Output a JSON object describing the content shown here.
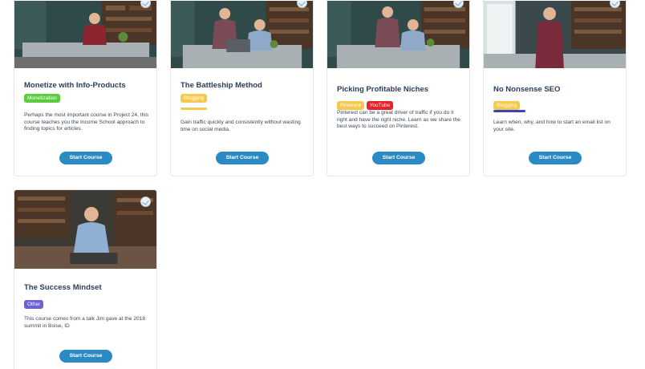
{
  "cards": [
    {
      "title": "Monetize with Info-Products",
      "tags": [
        {
          "label": "Monetization",
          "color": "#5ccc3f"
        }
      ],
      "description": "Perhaps the most important course in Project 24, this course teaches you the Income School approach to finding topics for articles.",
      "button": "Start Course"
    },
    {
      "title": "The Battleship Method",
      "tags": [
        {
          "label": "Blogging",
          "color": "#f6c84c"
        }
      ],
      "description": "Gain traffic quickly and consistently without wasting time on social media.",
      "button": "Start Course"
    },
    {
      "title": "Picking Profitable Niches",
      "tags": [
        {
          "label": "Pinterest",
          "color": "#f6c84c"
        },
        {
          "label": "YouTube",
          "color": "#e8222a"
        }
      ],
      "description": "Pinterest can be a great driver of traffic if you do it right and have the right niche. Learn as we share the best ways to succeed on Pinterest.",
      "button": "Start Course"
    },
    {
      "title": "No Nonsense SEO",
      "tags": [
        {
          "label": "Blogging",
          "color": "#f6c84c"
        }
      ],
      "description": "Learn when, why, and how to start an email list on your site.",
      "button": "Start Course"
    },
    {
      "title": "The Success Mindset",
      "tags": [
        {
          "label": "Other",
          "color": "#6b63cf"
        }
      ],
      "description": "This course comes from a talk Jim gave at the 2018 summit in Boise, ID",
      "button": "Start Course"
    }
  ]
}
